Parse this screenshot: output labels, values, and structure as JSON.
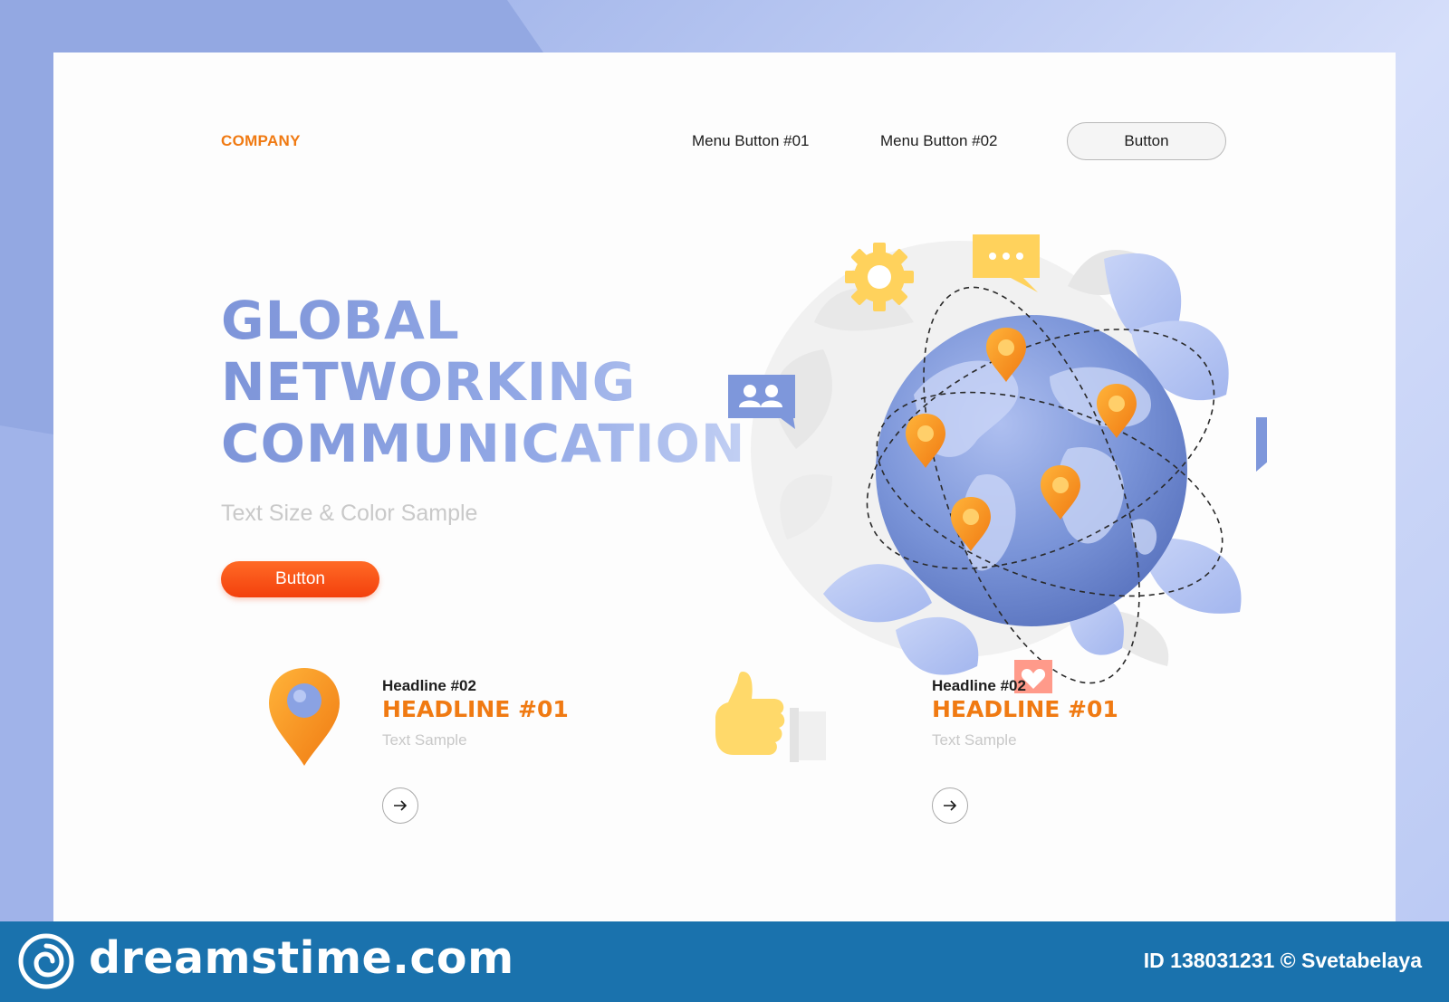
{
  "header": {
    "logo": "COMPANY",
    "menu": [
      "Menu Button #01",
      "Menu Button #02"
    ],
    "button_label": "Button"
  },
  "hero": {
    "title_lines": [
      "GLOBAL",
      "NETWORKING",
      "COMMUNICATION"
    ],
    "subtitle": "Text Size & Color Sample",
    "button_label": "Button"
  },
  "features": [
    {
      "icon": "map-pin-icon",
      "headline_small": "Headline #02",
      "headline_large": "HEADLINE #01",
      "text": "Text Sample"
    },
    {
      "icon": "thumbs-up-hand-icon",
      "headline_small": "Headline #02",
      "headline_large": "HEADLINE #01",
      "text": "Text Sample"
    }
  ],
  "illustration": {
    "center": "globe-icon",
    "pin_count": 6,
    "floating_icons": [
      "gear-icon",
      "chat-dots-icon",
      "users-chat-icon",
      "like-chat-icon",
      "heart-chat-icon"
    ]
  },
  "footer": {
    "brand": "dreamstime.com",
    "credit": "ID 138031231 © Svetabelaya"
  },
  "colors": {
    "accent_orange": "#f07a12",
    "hero_button": "#f3400d",
    "title_blue": "#7e95d9",
    "footer_blue": "#1a72ad",
    "globe_blue": "#6f8ad1"
  }
}
